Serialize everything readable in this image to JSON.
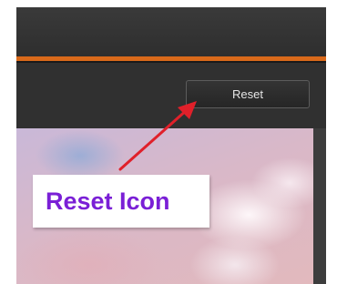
{
  "toolbar": {
    "reset_label": "Reset"
  },
  "annotation": {
    "callout_text": "Reset Icon"
  },
  "colors": {
    "accent_line": "#d9691a",
    "callout_text": "#7a1fd6",
    "arrow": "#e0202a"
  }
}
